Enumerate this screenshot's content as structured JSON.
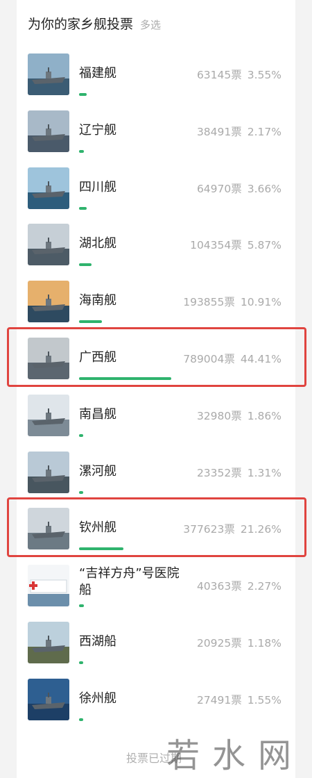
{
  "header": {
    "title": "为你的家乡舰投票",
    "mode": "多选"
  },
  "items": [
    {
      "name": "福建舰",
      "votes": "63145票",
      "percent": "3.55%",
      "share": 3.55,
      "icon": "aircraft-carrier-photo"
    },
    {
      "name": "辽宁舰",
      "votes": "38491票",
      "percent": "2.17%",
      "share": 2.17,
      "icon": "aircraft-carrier-photo"
    },
    {
      "name": "四川舰",
      "votes": "64970票",
      "percent": "3.66%",
      "share": 3.66,
      "icon": "amphibious-ship-photo"
    },
    {
      "name": "湖北舰",
      "votes": "104354票",
      "percent": "5.87%",
      "share": 5.87,
      "icon": "amphibious-ship-photo"
    },
    {
      "name": "海南舰",
      "votes": "193855票",
      "percent": "10.91%",
      "share": 10.91,
      "icon": "amphibious-ship-photo"
    },
    {
      "name": "广西舰",
      "votes": "789004票",
      "percent": "44.41%",
      "share": 44.41,
      "icon": "amphibious-ship-photo",
      "highlighted": true
    },
    {
      "name": "南昌舰",
      "votes": "32980票",
      "percent": "1.86%",
      "share": 1.86,
      "icon": "destroyer-photo"
    },
    {
      "name": "漯河舰",
      "votes": "23352票",
      "percent": "1.31%",
      "share": 1.31,
      "icon": "ship-photo"
    },
    {
      "name": "钦州舰",
      "votes": "377623票",
      "percent": "21.26%",
      "share": 21.26,
      "icon": "ship-photo",
      "highlighted": true
    },
    {
      "name": "“吉祥方舟”号医院船",
      "votes": "40363票",
      "percent": "2.27%",
      "share": 2.27,
      "icon": "hospital-ship-photo"
    },
    {
      "name": "西湖船",
      "votes": "20925票",
      "percent": "1.18%",
      "share": 1.18,
      "icon": "ship-photo"
    },
    {
      "name": "徐州舰",
      "votes": "27491票",
      "percent": "1.55%",
      "share": 1.55,
      "icon": "frigate-photo"
    }
  ],
  "footer": {
    "status": "投票已过期"
  },
  "watermark": {
    "text": "若水网"
  },
  "colors": {
    "bar": "#2fb36d",
    "highlight": "#e0443f",
    "muted": "#aaaaaa"
  }
}
